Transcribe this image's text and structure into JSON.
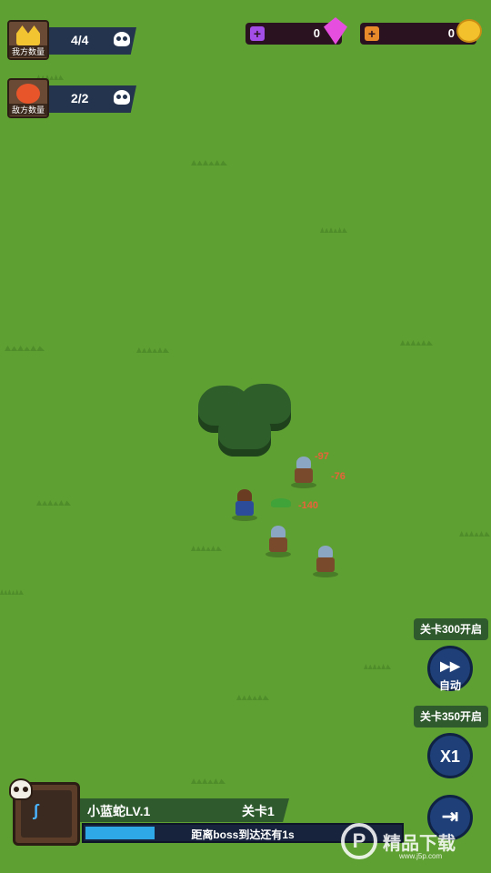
{
  "hud": {
    "ally": {
      "caption": "我方数量",
      "value": "4/4",
      "icon": "crown-icon"
    },
    "enemy": {
      "caption": "敌方数量",
      "value": "2/2",
      "icon": "pumpkin-icon"
    }
  },
  "currency": {
    "gems": {
      "amount": "0",
      "icon": "gem-icon",
      "plus": "+"
    },
    "coins": {
      "amount": "0",
      "icon": "coin-icon",
      "plus": "+"
    }
  },
  "battle": {
    "damage_numbers": [
      "-97",
      "-76",
      "-140"
    ]
  },
  "controls": {
    "auto_lock": "关卡300开启",
    "auto_label": "自动",
    "auto_icon": "▶▶",
    "speed_lock": "关卡350开启",
    "speed_label": "X1",
    "exit_icon": "⇥"
  },
  "hero": {
    "name": "小蓝蛇LV.1",
    "stage": "关卡1",
    "boss_timer": "距离boss到达还有1s",
    "progress_fraction": 0.22
  },
  "watermark": {
    "logo": "P",
    "brand": "精品下载",
    "url": "www.j5p.com"
  },
  "colors": {
    "grass": "#5fa032",
    "panel": "#24344f",
    "button": "#1f3f78",
    "progress": "#2fa8e8"
  }
}
